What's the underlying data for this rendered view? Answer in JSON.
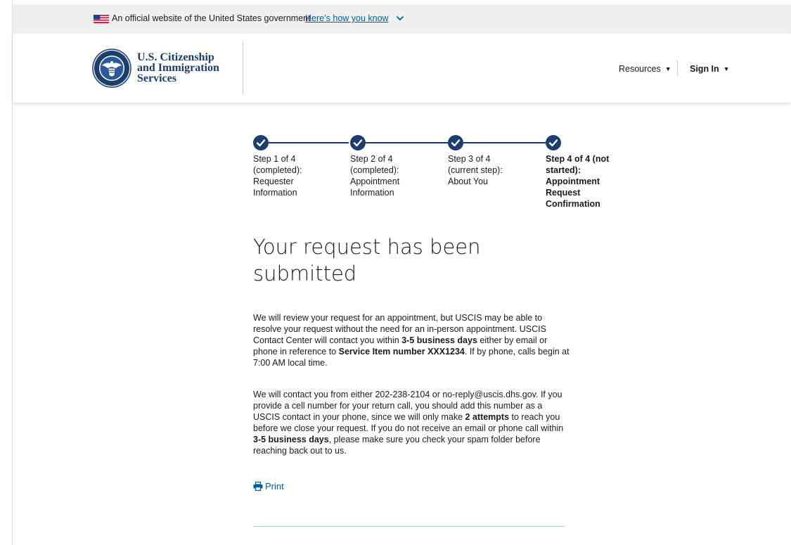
{
  "gov_banner": {
    "text": "An official website of the United States government",
    "link": "Here’s how you know",
    "flag_icon": "us-flag-icon",
    "chevron_icon": "chevron-down-icon"
  },
  "header": {
    "agency_line1": "U.S. Citizenship",
    "agency_line2": "and Immigration",
    "agency_line3": "Services",
    "logo_icon": "dhs-seal-icon",
    "nav": {
      "resources_label": "Resources",
      "signin_label": "Sign In"
    }
  },
  "steps": [
    {
      "lines": [
        "Step 1 of 4",
        "(completed):",
        "Requester",
        "Information"
      ],
      "status": "completed"
    },
    {
      "lines": [
        "Step 2 of 4",
        "(completed):",
        "Appointment",
        "Information"
      ],
      "status": "completed"
    },
    {
      "lines": [
        "Step 3 of 4",
        "(current step):",
        "About You"
      ],
      "status": "current"
    },
    {
      "lines": [
        "Step 4 of 4 (not",
        "started):",
        "Appointment",
        "Request",
        "Confirmation"
      ],
      "status": "not started"
    }
  ],
  "main": {
    "title_line1": "Your request has been",
    "title_line2": "submitted",
    "para1": {
      "t1": "We will review your request for an appointment, but USCIS may be able to resolve your request without the need for an in-person appointment. USCIS Contact Center will contact you within ",
      "b1": "3-5 business days",
      "t2": " either by email or phone in reference to ",
      "b2": "Service Item number XXX1234",
      "t3": ". If by phone, calls begin at 7:00 AM local time."
    },
    "para2": {
      "t1": "We will contact you from either 202-238-2104 or no-reply@uscis.dhs.gov. If you provide a cell number for your return call, you should add this number as a USCIS contact in your phone, since we will only make ",
      "b1": "2 attempts",
      "t2": " to reach you before we close your request. If you do not receive an email or phone call within ",
      "b2": "3-5 business days",
      "t3": ", please make sure you check your spam folder before reaching back out to us."
    },
    "print_label": "Print",
    "print_icon": "printer-icon"
  },
  "colors": {
    "primary_navy": "#1b3e6f",
    "link_blue": "#005ea2",
    "banner_bg": "#f0f0f0"
  }
}
